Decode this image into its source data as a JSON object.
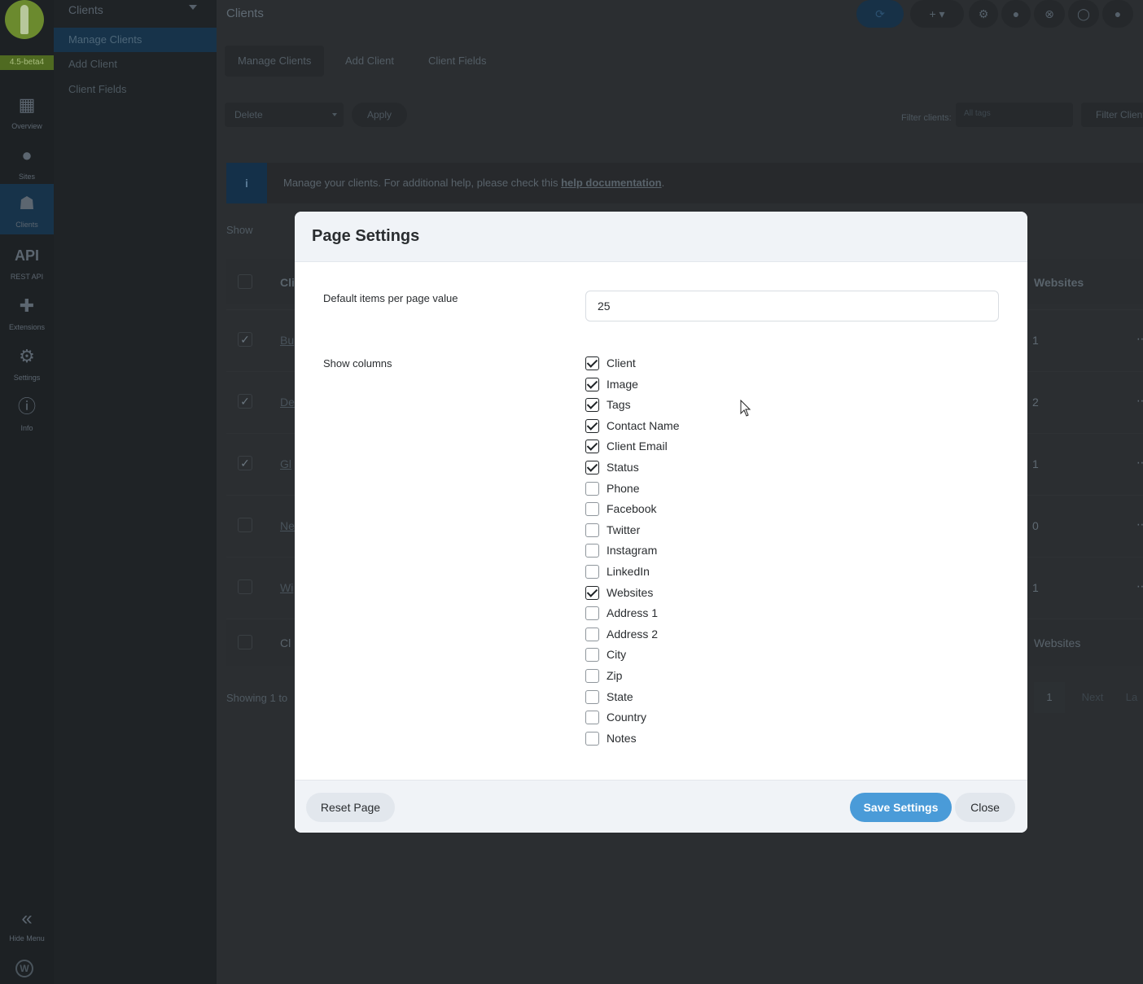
{
  "rail": {
    "version": "4.5-beta4",
    "items": [
      {
        "label": "Overview",
        "icon": "grid-icon"
      },
      {
        "label": "Sites",
        "icon": "globe-icon"
      },
      {
        "label": "Clients",
        "icon": "users-icon"
      },
      {
        "label": "REST API",
        "icon": "api-icon",
        "glyph": "API"
      },
      {
        "label": "Extensions",
        "icon": "puzzle-icon"
      },
      {
        "label": "Settings",
        "icon": "gear-icon"
      },
      {
        "label": "Info",
        "icon": "info-icon"
      }
    ],
    "hide_menu": "Hide Menu"
  },
  "submenu": {
    "title": "Clients",
    "items": [
      "Manage Clients",
      "Add Client",
      "Client Fields"
    ]
  },
  "topbar": {
    "title": "Clients"
  },
  "tabs": [
    "Manage Clients",
    "Add Client",
    "Client Fields"
  ],
  "bulk": {
    "action": "Delete",
    "apply": "Apply",
    "filter_label": "Filter clients:",
    "filter_placeholder": "All tags",
    "filter_button": "Filter Clients"
  },
  "notice": {
    "text": "Manage your clients. For additional help, please check this ",
    "link": "help documentation",
    "suffix": "."
  },
  "table": {
    "show_label": "Show",
    "head_client": "Cli",
    "head_websites": "Websites",
    "rows": [
      {
        "name": "Bu",
        "websites": "1",
        "checked": true
      },
      {
        "name": "De",
        "websites": "2",
        "checked": true
      },
      {
        "name": "Gl",
        "websites": "1",
        "checked": true
      },
      {
        "name": "Ne",
        "websites": "0",
        "checked": false
      },
      {
        "name": "Wi",
        "websites": "1",
        "checked": false
      }
    ],
    "foot_client": "Cl",
    "foot_websites": "Websites",
    "showing": "Showing 1 to",
    "page": "1",
    "next": "Next",
    "last": "La"
  },
  "modal": {
    "title": "Page Settings",
    "items_label": "Default items per page value",
    "items_value": "25",
    "columns_label": "Show columns",
    "columns": [
      {
        "label": "Client",
        "checked": true
      },
      {
        "label": "Image",
        "checked": true
      },
      {
        "label": "Tags",
        "checked": true
      },
      {
        "label": "Contact Name",
        "checked": true
      },
      {
        "label": "Client Email",
        "checked": true
      },
      {
        "label": "Status",
        "checked": true
      },
      {
        "label": "Phone",
        "checked": false
      },
      {
        "label": "Facebook",
        "checked": false
      },
      {
        "label": "Twitter",
        "checked": false
      },
      {
        "label": "Instagram",
        "checked": false
      },
      {
        "label": "LinkedIn",
        "checked": false
      },
      {
        "label": "Websites",
        "checked": true
      },
      {
        "label": "Address 1",
        "checked": false
      },
      {
        "label": "Address 2",
        "checked": false
      },
      {
        "label": "City",
        "checked": false
      },
      {
        "label": "Zip",
        "checked": false
      },
      {
        "label": "State",
        "checked": false
      },
      {
        "label": "Country",
        "checked": false
      },
      {
        "label": "Notes",
        "checked": false
      }
    ],
    "reset_label": "Reset Page",
    "save_label": "Save Settings",
    "close_label": "Close"
  },
  "colors": {
    "accent": "#4a9bd8",
    "overlay": "#2b2e31",
    "version_badge": "#4f6a21"
  }
}
